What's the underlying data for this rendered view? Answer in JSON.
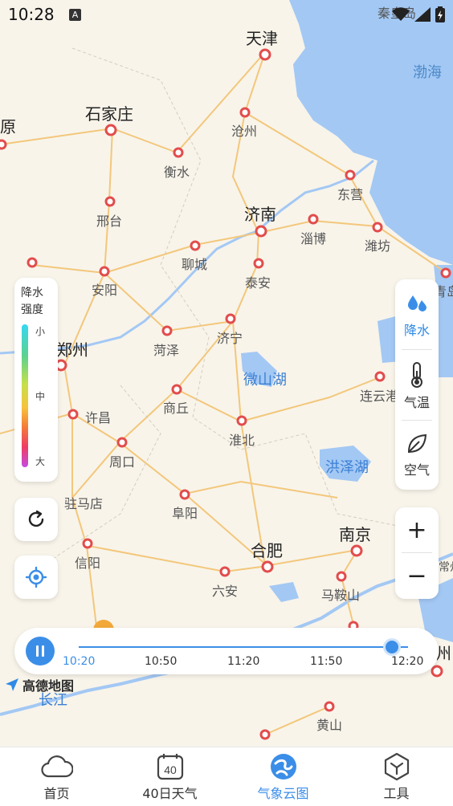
{
  "status_bar": {
    "time": "10:28",
    "indicator": "A"
  },
  "map": {
    "cities": [
      {
        "id": "tianjin",
        "name": "天津",
        "big": true
      },
      {
        "id": "shijiazhuang",
        "name": "石家庄",
        "big": true
      },
      {
        "id": "cangzhou",
        "name": "沧州"
      },
      {
        "id": "hengshui",
        "name": "衡水"
      },
      {
        "id": "dongying",
        "name": "东营"
      },
      {
        "id": "xingtai",
        "name": "邢台"
      },
      {
        "id": "jinan",
        "name": "济南",
        "big": true
      },
      {
        "id": "zibo",
        "name": "淄博"
      },
      {
        "id": "weifang",
        "name": "潍坊"
      },
      {
        "id": "liaocheng",
        "name": "聊城"
      },
      {
        "id": "anyang",
        "name": "安阳"
      },
      {
        "id": "taian",
        "name": "泰安"
      },
      {
        "id": "qingdao",
        "name": "青岛"
      },
      {
        "id": "heze",
        "name": "菏泽"
      },
      {
        "id": "jining",
        "name": "济宁"
      },
      {
        "id": "zhengzhou",
        "name": "郑州",
        "big": true
      },
      {
        "id": "shangqiu",
        "name": "商丘"
      },
      {
        "id": "lianyungang",
        "name": "连云港"
      },
      {
        "id": "xuchang",
        "name": "许昌"
      },
      {
        "id": "huaibei",
        "name": "淮北"
      },
      {
        "id": "zhoukou",
        "name": "周口"
      },
      {
        "id": "zhumadian",
        "name": "驻马店"
      },
      {
        "id": "fuyang",
        "name": "阜阳"
      },
      {
        "id": "nanjing",
        "name": "南京",
        "big": true
      },
      {
        "id": "hefei",
        "name": "合肥",
        "big": true
      },
      {
        "id": "xinyang",
        "name": "信阳"
      },
      {
        "id": "changzhou",
        "name": "常州"
      },
      {
        "id": "maanshan",
        "name": "马鞍山"
      },
      {
        "id": "luan",
        "name": "六安"
      },
      {
        "id": "huangshan",
        "name": "黄山"
      },
      {
        "id": "taiyuan",
        "name": "原",
        "big": true
      },
      {
        "id": "qinhuangdao",
        "name": "秦皇岛"
      },
      {
        "id": "suzhou",
        "name": "州",
        "big": true
      }
    ],
    "lakes": [
      {
        "id": "weishan",
        "name": "微山湖"
      },
      {
        "id": "hongze",
        "name": "洪泽湖"
      }
    ],
    "seas": [
      {
        "id": "bohai",
        "name": "渤海"
      }
    ],
    "river_label": "长江",
    "attribution": "高德地图"
  },
  "precip_legend": {
    "title_line1": "降水",
    "title_line2": "强度",
    "low": "小",
    "mid": "中",
    "high": "大",
    "gradient_colors": [
      "#36d8f2",
      "#5ad28f",
      "#c6e04a",
      "#f7c33c",
      "#f47a3a",
      "#ee3c66",
      "#c44be0"
    ]
  },
  "controls": {
    "refresh_icon": "refresh-icon",
    "locate_icon": "locate-icon"
  },
  "layers": [
    {
      "label": "降水",
      "icon": "water-drops-icon",
      "active": true
    },
    {
      "label": "气温",
      "icon": "thermometer-icon",
      "active": false
    },
    {
      "label": "空气",
      "icon": "leaf-icon",
      "active": false
    }
  ],
  "zoom": {
    "in": "+",
    "out": "−"
  },
  "timeline": {
    "ticks": [
      "10:20",
      "10:50",
      "11:20",
      "11:50",
      "12:20"
    ],
    "progress": 1.0,
    "state": "playing",
    "accent": "#3b8ee8"
  },
  "nav": [
    {
      "label": "首页",
      "icon": "cloud-icon",
      "active": false
    },
    {
      "label": "40日天气",
      "icon": "calendar-40-icon",
      "badge": "40",
      "active": false
    },
    {
      "label": "气象云图",
      "icon": "cloud-map-icon",
      "active": true
    },
    {
      "label": "工具",
      "icon": "toolbox-icon",
      "active": false
    }
  ]
}
